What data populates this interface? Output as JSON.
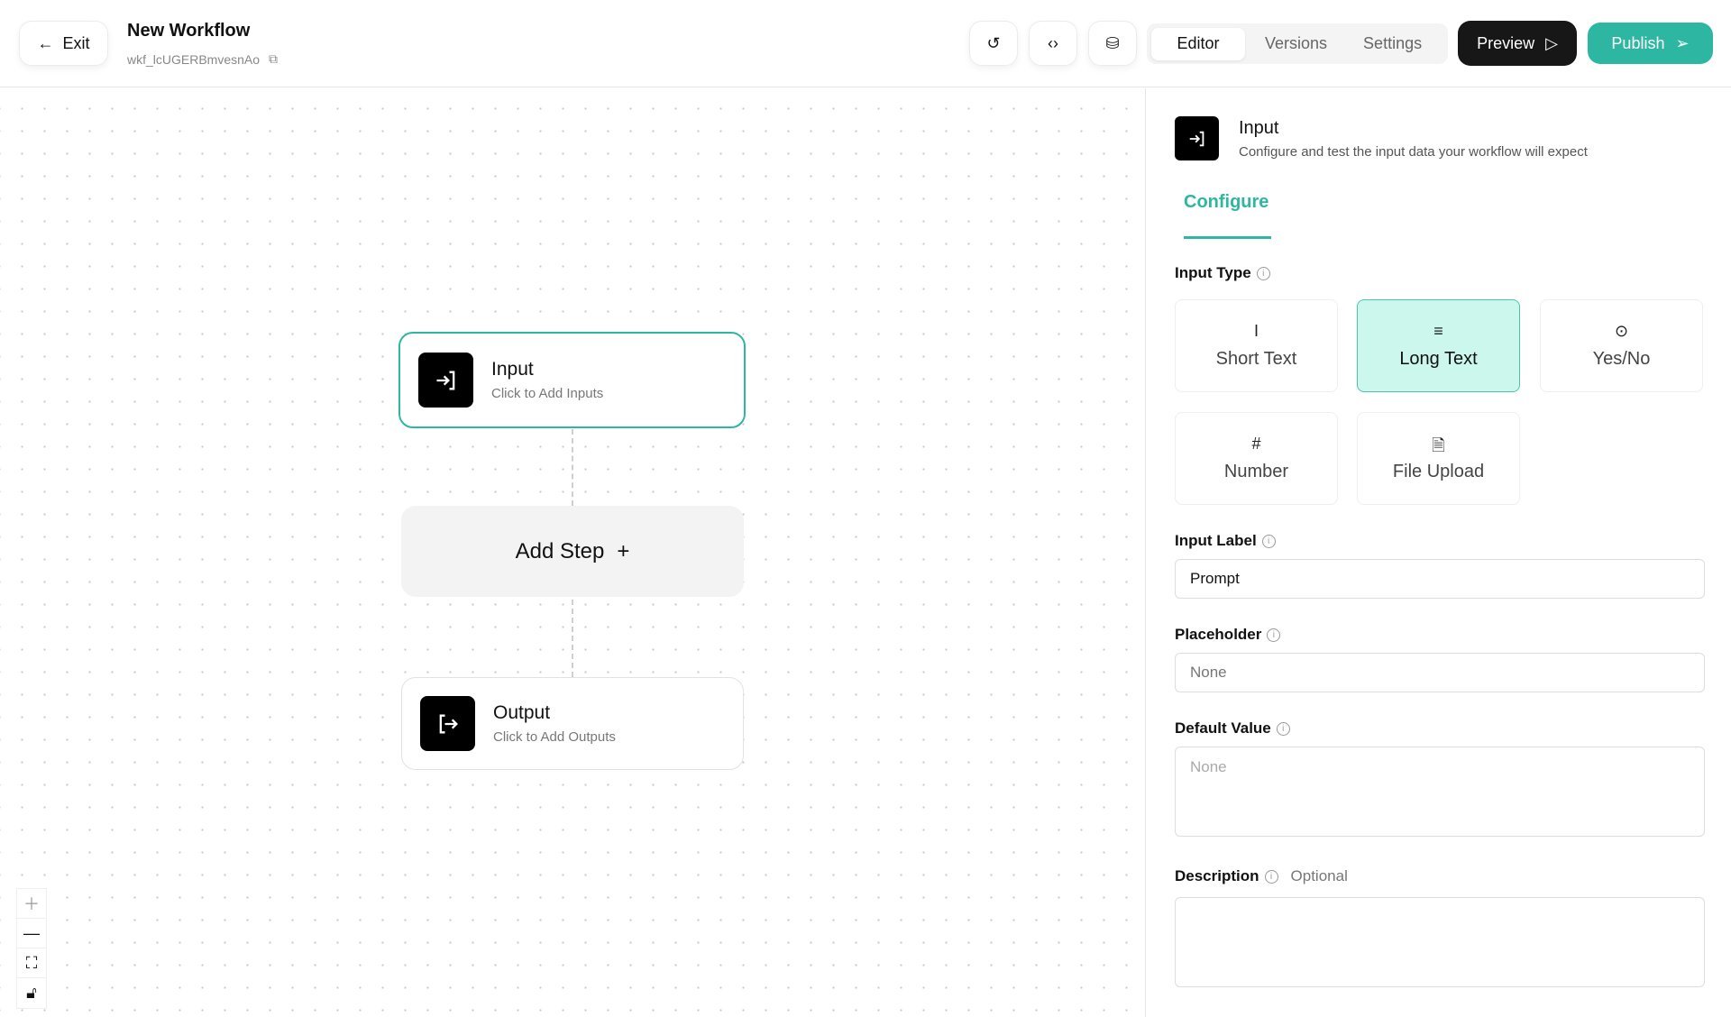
{
  "header": {
    "exit_label": "Exit",
    "title": "New Workflow",
    "workflow_id": "wkf_lcUGERBmvesnAo",
    "tabs": [
      "Editor",
      "Versions",
      "Settings"
    ],
    "active_tab": "Editor",
    "preview_label": "Preview",
    "publish_label": "Publish"
  },
  "canvas": {
    "input_node": {
      "title": "Input",
      "subtitle": "Click to Add Inputs"
    },
    "add_step_label": "Add Step",
    "output_node": {
      "title": "Output",
      "subtitle": "Click to Add Outputs"
    }
  },
  "panel": {
    "title": "Input",
    "subtitle": "Configure and test the input data your workflow will expect",
    "tab": "Configure",
    "input_type_label": "Input Type",
    "input_types": [
      {
        "label": "Short Text",
        "icon": "text-cursor-icon"
      },
      {
        "label": "Long Text",
        "icon": "align-left-icon",
        "selected": true
      },
      {
        "label": "Yes/No",
        "icon": "toggle-icon"
      },
      {
        "label": "Number",
        "icon": "hash-icon"
      },
      {
        "label": "File Upload",
        "icon": "file-upload-icon"
      }
    ],
    "input_label": {
      "label": "Input Label",
      "value": "Prompt"
    },
    "placeholder": {
      "label": "Placeholder",
      "placeholder": "None"
    },
    "default_value": {
      "label": "Default Value",
      "placeholder": "None"
    },
    "description": {
      "label": "Description",
      "optional": "Optional"
    }
  },
  "colors": {
    "accent": "#2db7a3",
    "selected_bg": "#ccf7ec",
    "dark": "#171717"
  }
}
